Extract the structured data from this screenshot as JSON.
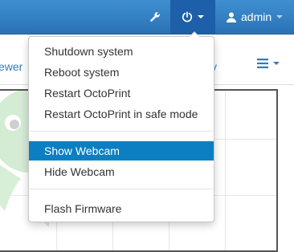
{
  "navbar": {
    "user_label": "admin"
  },
  "tabs": {
    "left_partial": "ewer",
    "right_partial": "y"
  },
  "power_menu": {
    "items": [
      "Shutdown system",
      "Reboot system",
      "Restart OctoPrint",
      "Restart OctoPrint in safe mode",
      "Show Webcam",
      "Hide Webcam",
      "Flash Firmware"
    ],
    "active_item": "Show Webcam"
  },
  "icons": {
    "settings": "wrench-icon",
    "power": "power-icon",
    "user": "user-icon",
    "list_menu": "list-icon"
  },
  "colors": {
    "navbar": "#2a72b5",
    "active_item": "#0b7fc1",
    "link": "#337ab7",
    "logo_green": "#4caf50"
  }
}
